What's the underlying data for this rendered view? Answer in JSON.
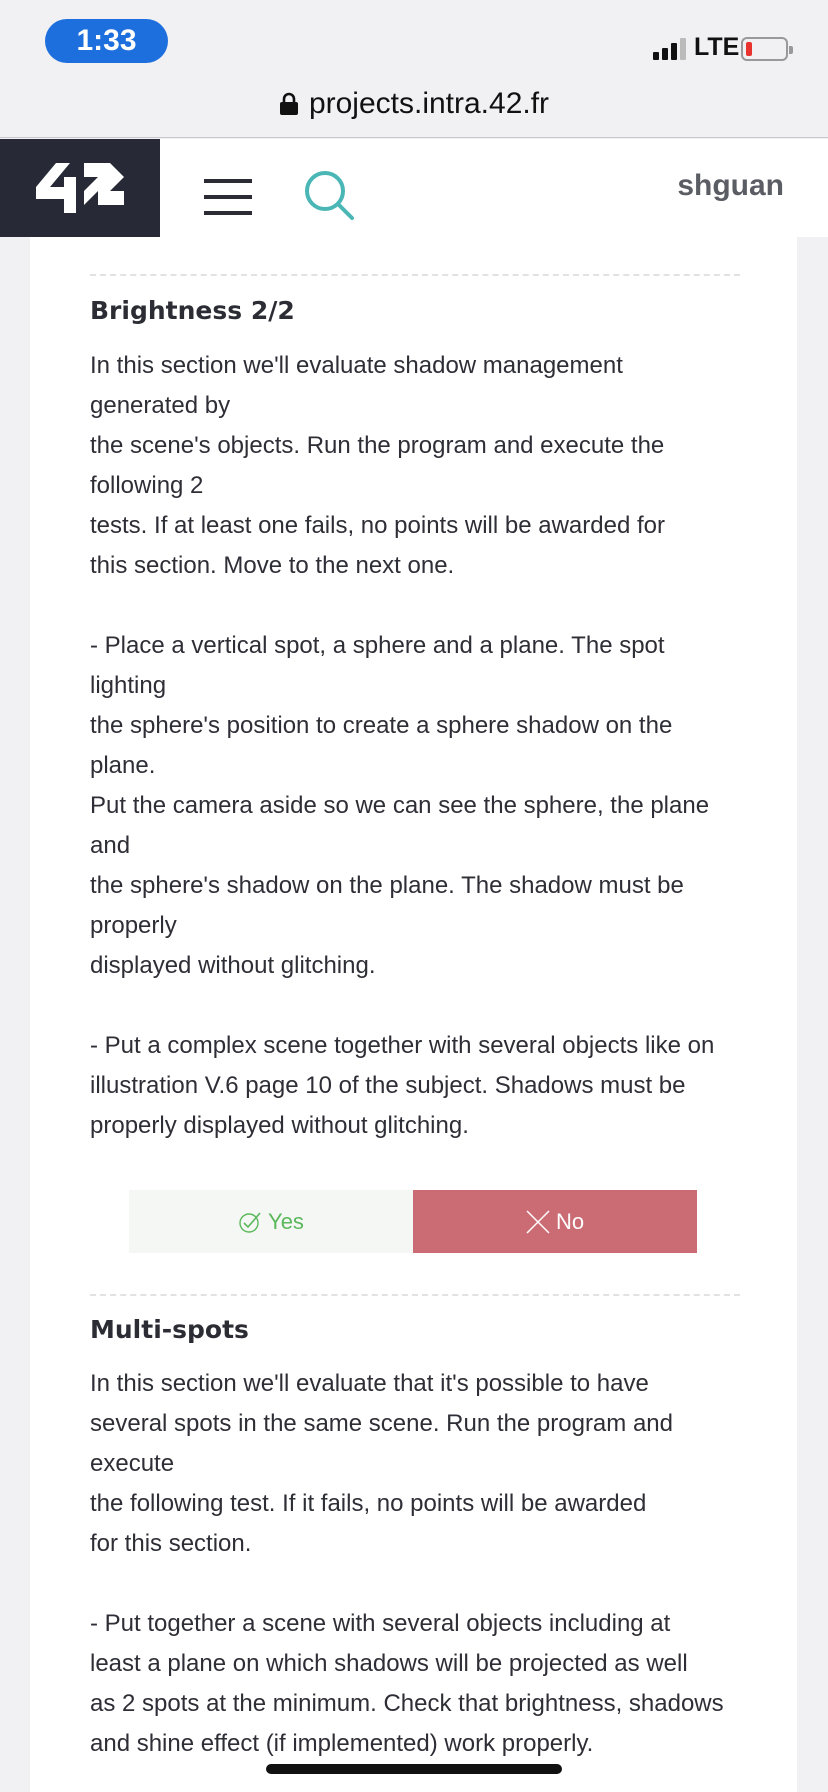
{
  "status_bar": {
    "time": "1:33",
    "network": "LTE",
    "battery_color": "#e8332e"
  },
  "browser": {
    "url": "projects.intra.42.fr"
  },
  "header": {
    "logo_text": "42",
    "username": "shguan",
    "menu_icon": "hamburger-icon",
    "search_icon": "search-icon"
  },
  "sections": [
    {
      "title": "Brightness 2/2",
      "body": "In this section we'll evaluate shadow management\ngenerated by\nthe scene's objects. Run the program and execute the\nfollowing 2\ntests. If at least one fails, no points will be awarded for\nthis section. Move to the next one.\n\n- Place a vertical spot, a sphere and a plane. The spot\nlighting\nthe sphere's position to create a sphere shadow on the\nplane.\nPut the camera aside so we can see the sphere, the plane\nand\nthe sphere's shadow on the plane. The shadow must be\nproperly\ndisplayed without glitching.\n\n- Put a complex scene together with several objects like on\nillustration V.6 page 10 of the subject. Shadows must be\nproperly displayed without glitching."
    },
    {
      "title": "Multi-spots",
      "body": "In this section we'll evaluate that it's possible to have\nseveral spots in the same scene. Run the program and\nexecute\nthe following test. If it fails, no points will be awarded\nfor this section.\n\n- Put together a scene with several objects including at\nleast a plane on which shadows will be projected as well\nas 2 spots at the minimum. Check that brightness, shadows\nand shine effect (if implemented) work properly."
    }
  ],
  "answer_buttons": {
    "yes_label": "Yes",
    "no_label": "No",
    "yes_color": "#5cb85c",
    "no_color": "#cb6b73"
  }
}
